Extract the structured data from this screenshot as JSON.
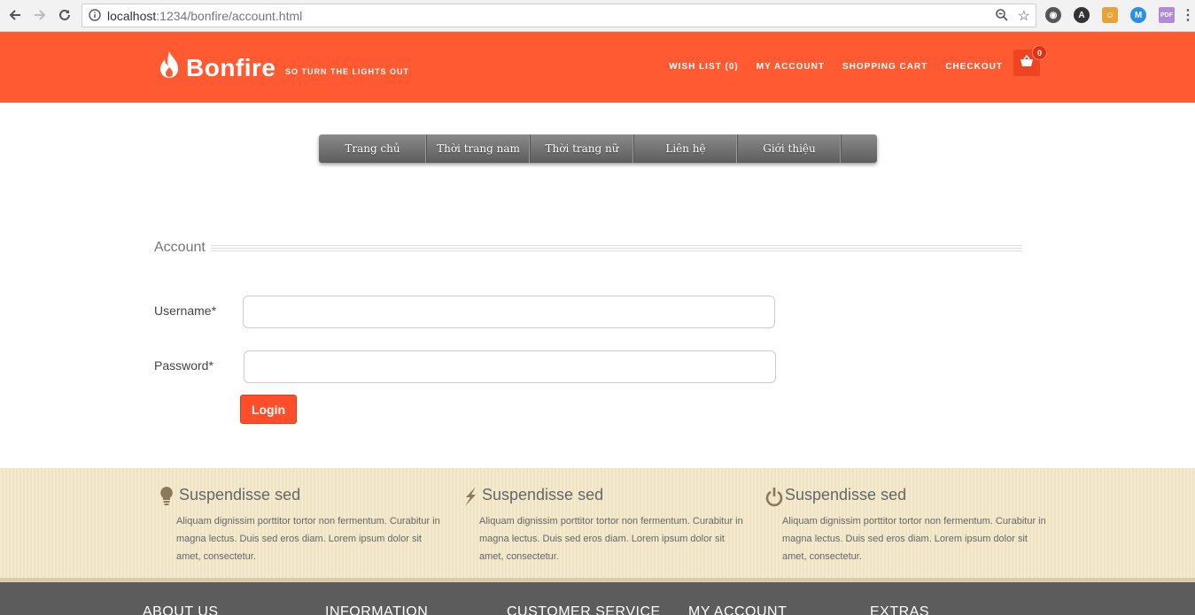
{
  "browser": {
    "url_host": "localhost",
    "url_rest": ":1234/bonfire/account.html"
  },
  "header": {
    "logo_text": "Bonfire",
    "tagline": "SO TURN THE LIGHTS OUT",
    "links": [
      "WISH LIST (0)",
      "MY ACCOUNT",
      "SHOPPING CART",
      "CHECKOUT"
    ],
    "cart_count": "0"
  },
  "menu": {
    "items": [
      "Trang chủ",
      "Thời trang nam",
      "Thời trang nữ",
      "Liên hệ",
      "Giới thiệu"
    ]
  },
  "account": {
    "title": "Account",
    "username_label": "Username*",
    "password_label": "Password*",
    "login_label": "Login"
  },
  "features": [
    {
      "icon": "lightbulb-icon",
      "title": "Suspendisse sed",
      "text": "Aliquam dignissim porttitor tortor non fermentum. Curabitur in magna lectus. Duis sed eros diam. Lorem ipsum dolor sit amet, consectetur."
    },
    {
      "icon": "lightning-icon",
      "title": "Suspendisse sed",
      "text": "Aliquam dignissim porttitor tortor non fermentum. Curabitur in magna lectus. Duis sed eros diam. Lorem ipsum dolor sit amet, consectetur."
    },
    {
      "icon": "power-icon",
      "title": "Suspendisse sed",
      "text": "Aliquam dignissim porttitor tortor non fermentum. Curabitur in magna lectus. Duis sed eros diam. Lorem ipsum dolor sit amet, consectetur."
    }
  ],
  "footer": {
    "columns": [
      "ABOUT US",
      "INFORMATION",
      "CUSTOMER SERVICE",
      "MY ACCOUNT",
      "EXTRAS"
    ]
  },
  "colors": {
    "brand": "#ff5a31",
    "menu": "#6e6e6e",
    "features_bg": "#f1e6c9",
    "footer_bg": "#5c5c5c"
  }
}
